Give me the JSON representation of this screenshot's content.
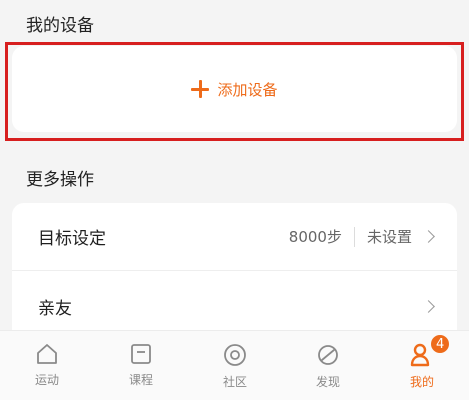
{
  "sections": {
    "devices_title": "我的设备",
    "more_title": "更多操作"
  },
  "add_device": {
    "label": "添加设备",
    "accent": "#ee6b1a",
    "icon": "plus-icon"
  },
  "operations": [
    {
      "label": "目标设定",
      "value": "8000步",
      "status": "未设置"
    },
    {
      "label": "亲友"
    }
  ],
  "tabbar": {
    "items": [
      {
        "label": "运动",
        "icon": "home-icon",
        "active": false
      },
      {
        "label": "课程",
        "icon": "course-icon",
        "active": false
      },
      {
        "label": "社区",
        "icon": "community-icon",
        "active": false
      },
      {
        "label": "发现",
        "icon": "discover-icon",
        "active": false
      },
      {
        "label": "我的",
        "icon": "profile-icon",
        "active": true,
        "badge": "4"
      }
    ]
  }
}
